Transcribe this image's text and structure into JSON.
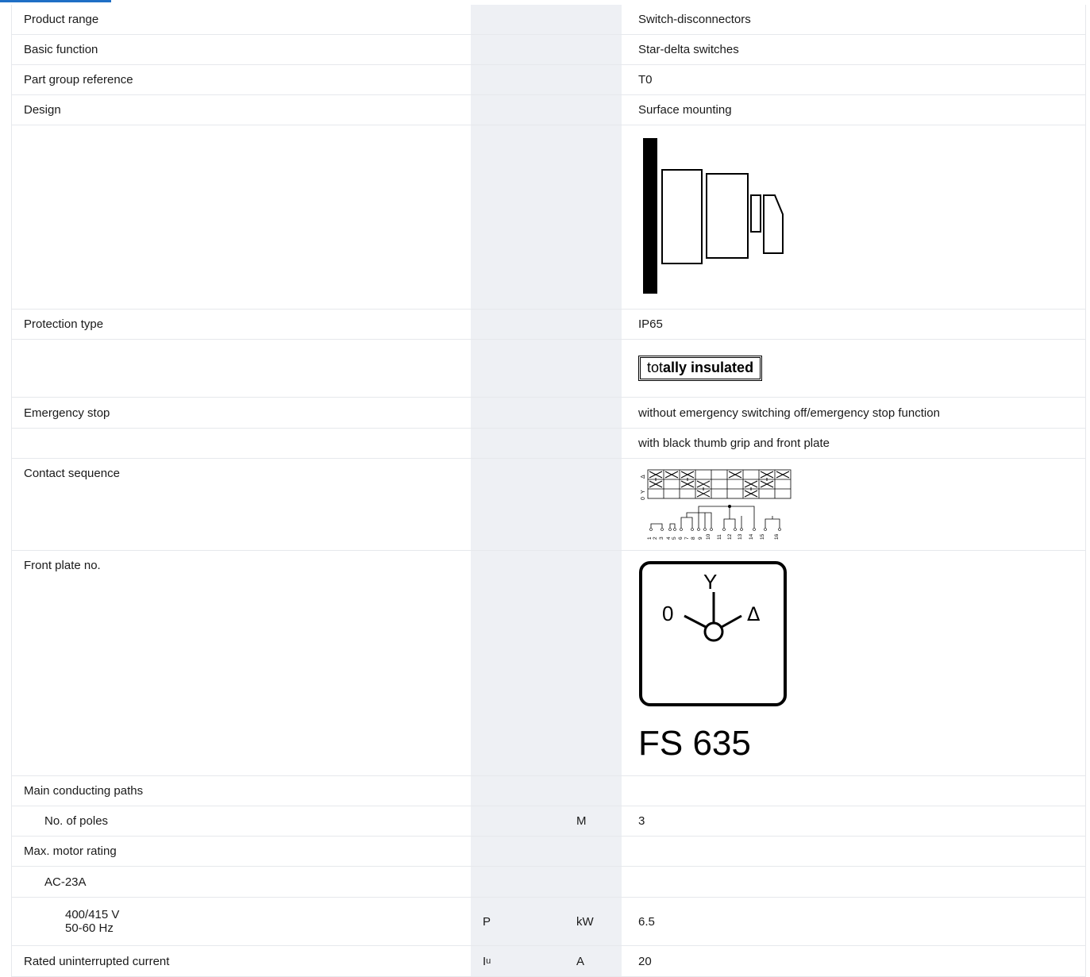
{
  "rows": {
    "r1": {
      "label": "Product range",
      "value": "Switch-disconnectors"
    },
    "r2": {
      "label": "Basic function",
      "value": "Star-delta switches"
    },
    "r3": {
      "label": "Part group reference",
      "value": "T0"
    },
    "r4": {
      "label": "Design",
      "value": "Surface mounting"
    },
    "r6": {
      "label": "Protection type",
      "value": "IP65"
    },
    "r7": {
      "badge_part1": "tot",
      "badge_part2": "ally",
      "badge_part3": " insulated"
    },
    "r8": {
      "label": "Emergency stop",
      "value": "without emergency switching off/emergency stop function"
    },
    "r9": {
      "value": "with black thumb grip and front plate"
    },
    "r10": {
      "label": "Contact sequence",
      "positions": [
        "0",
        "Y",
        "Δ"
      ],
      "terminals": [
        "1",
        "2",
        "3",
        "4",
        "5",
        "6",
        "7",
        "8",
        "9",
        "10",
        "11",
        "12",
        "13",
        "14",
        "15",
        "16"
      ]
    },
    "r11": {
      "label": "Front plate no.",
      "plate_left": "0",
      "plate_top": "Y",
      "plate_right": "Δ",
      "plate_code": "FS 635"
    },
    "r12": {
      "label": "Main conducting paths"
    },
    "r13": {
      "label": "No. of poles",
      "unit": "M",
      "value": "3"
    },
    "r14": {
      "label": "Max. motor rating"
    },
    "r15": {
      "label": "AC-23A"
    },
    "r16": {
      "label_line1": "400/415 V",
      "label_line2": "50-60 Hz",
      "symbol": "P",
      "unit": "kW",
      "value": "6.5"
    },
    "r17": {
      "label": "Rated uninterrupted current",
      "symbol_main": "I",
      "symbol_sub": "u",
      "unit": "A",
      "value": "20"
    }
  }
}
